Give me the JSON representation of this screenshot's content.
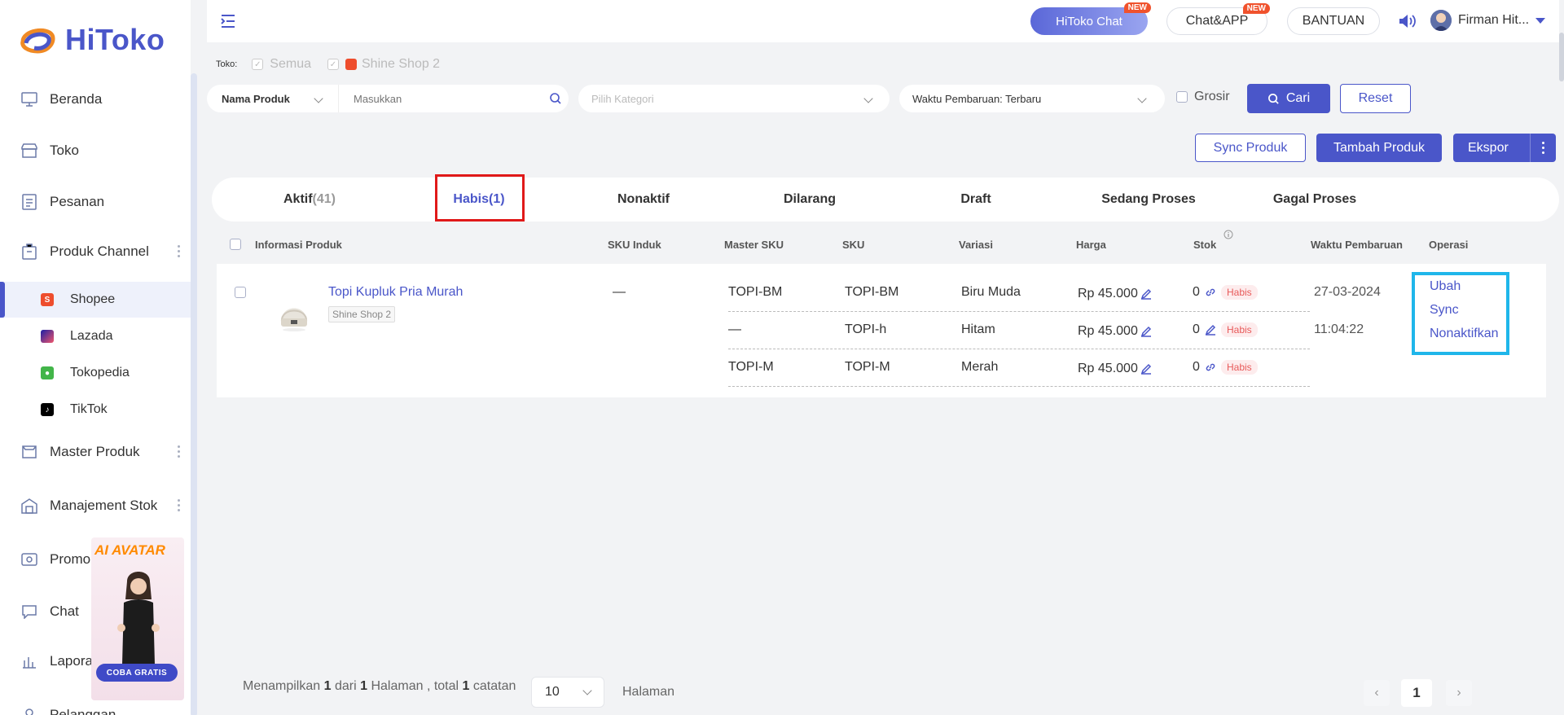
{
  "app": {
    "logo_text": "HiToko"
  },
  "sidebar": {
    "items": [
      {
        "label": "Beranda",
        "icon": "monitor-icon"
      },
      {
        "label": "Toko",
        "icon": "store-icon"
      },
      {
        "label": "Pesanan",
        "icon": "orders-icon"
      },
      {
        "label": "Produk Channel",
        "icon": "product-channel-icon"
      },
      {
        "label": "Master Produk",
        "icon": "master-product-icon"
      },
      {
        "label": "Manajement Stok",
        "icon": "warehouse-icon"
      },
      {
        "label": "Promo",
        "icon": "promo-icon"
      },
      {
        "label": "Chat",
        "icon": "chat-icon"
      },
      {
        "label": "Lapora",
        "icon": "report-icon"
      },
      {
        "label": "Pelanggan",
        "icon": "customer-icon"
      }
    ],
    "sub_items": [
      {
        "label": "Shopee",
        "color": "#ee4d2d"
      },
      {
        "label": "Lazada",
        "color": "#1a1fa6"
      },
      {
        "label": "Tokopedia",
        "color": "#42b549"
      },
      {
        "label": "TikTok",
        "color": "#000000"
      }
    ],
    "banner": {
      "title": "AI AVATAR",
      "cta": "COBA GRATIS"
    }
  },
  "header": {
    "chat_btn": "HiToko Chat",
    "chatapp_btn": "Chat&APP",
    "new_badge": "NEW",
    "help_btn": "BANTUAN",
    "user_name": "Firman Hit..."
  },
  "filters": {
    "toko_label": "Toko:",
    "semua": "Semua",
    "shop": "Shine Shop 2",
    "field_select": "Nama Produk",
    "search_placeholder": "Masukkan",
    "category_placeholder": "Pilih Kategori",
    "sort_select": "Waktu Pembaruan: Terbaru",
    "grosir": "Grosir",
    "search_btn": "Cari",
    "reset_btn": "Reset"
  },
  "actions": {
    "sync": "Sync Produk",
    "add": "Tambah Produk",
    "export": "Ekspor"
  },
  "tabs": [
    {
      "label": "Aktif",
      "count": "(41)"
    },
    {
      "label": "Habis",
      "count": "(1)"
    },
    {
      "label": "Nonaktif",
      "count": ""
    },
    {
      "label": "Dilarang",
      "count": ""
    },
    {
      "label": "Draft",
      "count": ""
    },
    {
      "label": "Sedang Proses",
      "count": ""
    },
    {
      "label": "Gagal Proses",
      "count": ""
    }
  ],
  "table": {
    "columns": [
      "Informasi Produk",
      "SKU Induk",
      "Master SKU",
      "SKU",
      "Variasi",
      "Harga",
      "Stok",
      "Waktu Pembaruan",
      "Operasi"
    ],
    "product": {
      "name": "Topi Kupluk Pria Murah",
      "shop": "Shine Shop 2",
      "sku_induk": "—",
      "date": "27-03-2024",
      "time": "11:04:22",
      "variants": [
        {
          "master_sku": "TOPI-BM",
          "sku": "TOPI-BM",
          "variasi": "Biru Muda",
          "harga": "Rp 45.000",
          "stok": "0",
          "status": "Habis"
        },
        {
          "master_sku": "—",
          "sku": "TOPI-h",
          "variasi": "Hitam",
          "harga": "Rp 45.000",
          "stok": "0",
          "status": "Habis"
        },
        {
          "master_sku": "TOPI-M",
          "sku": "TOPI-M",
          "variasi": "Merah",
          "harga": "Rp 45.000",
          "stok": "0",
          "status": "Habis"
        }
      ]
    },
    "operations": [
      "Ubah",
      "Sync",
      "Nonaktifkan"
    ]
  },
  "footer": {
    "t1": "Menampilkan",
    "page": "1",
    "t2": "dari",
    "pages": "1",
    "t3": "Halaman , total",
    "total": "1",
    "t4": "catatan",
    "page_size": "10",
    "halaman": "Halaman",
    "current_page": "1"
  },
  "colors": {
    "accent": "#4a56c9",
    "highlight_red": "#e01919",
    "highlight_cyan": "#1fb6ea"
  }
}
